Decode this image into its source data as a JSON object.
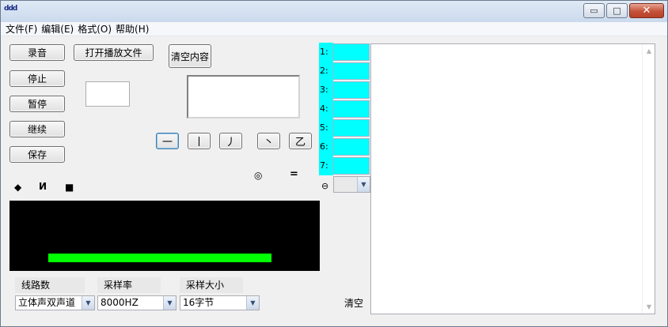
{
  "window": {
    "title": "ddd",
    "controls": {
      "minimize": "▭",
      "maximize": "□",
      "close": "✕"
    }
  },
  "menu": [
    {
      "label": "文件(F)"
    },
    {
      "label": "编辑(E)"
    },
    {
      "label": "格式(O)"
    },
    {
      "label": "帮助(H)"
    }
  ],
  "buttons": {
    "record": "录音",
    "stop": "停止",
    "pause": "暂停",
    "resume": "继续",
    "save": "保存",
    "open_play": "打开播放文件",
    "clear_content": "清空内容"
  },
  "strokes": [
    "一",
    "丨",
    "丿",
    "丶",
    "乙"
  ],
  "symbols": {
    "diamond": "◆",
    "letter_i": "И",
    "square": "■",
    "circle": "◎",
    "equals": "="
  },
  "level_meter": {
    "level": 0.73
  },
  "settings": {
    "channels": {
      "label": "线路数",
      "value": "立体声双声道"
    },
    "sample_rate": {
      "label": "采样率",
      "value": "8000HZ"
    },
    "sample_size": {
      "label": "采样大小",
      "value": "16字节"
    }
  },
  "slots": {
    "numbers": [
      "1:",
      "2:",
      "3:",
      "4:",
      "5:",
      "6:",
      "7:"
    ],
    "combo_icon": "⊖"
  },
  "clear_label": "清空",
  "colors": {
    "slot": "#00ffff",
    "level": "#00ff00",
    "display": "#000000"
  }
}
